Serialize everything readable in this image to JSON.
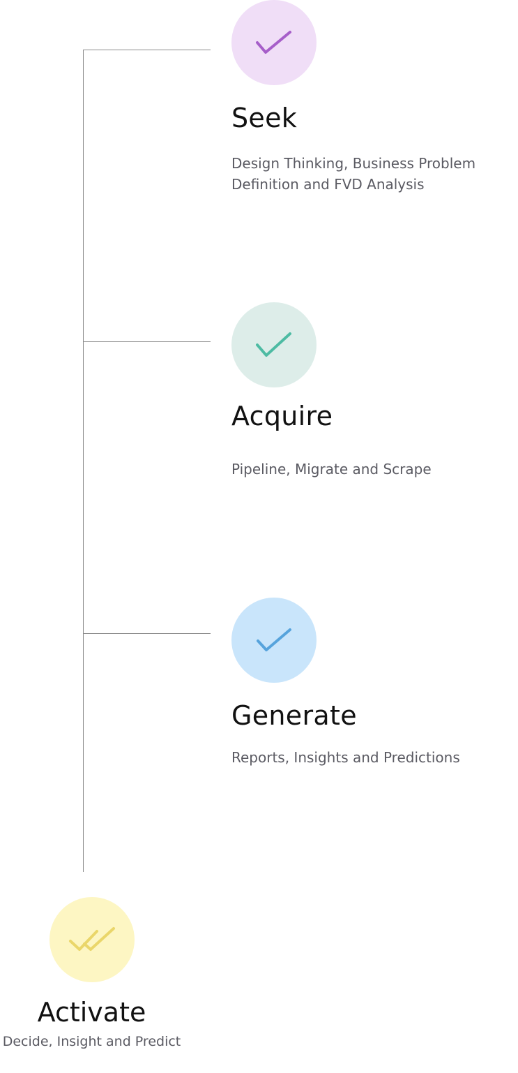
{
  "steps": [
    {
      "title": "Seek",
      "description": "Design Thinking, Business Problem Definition and FVD Analysis",
      "icon": "check-icon",
      "circle_color": "#f0def7",
      "check_color": "#a65ec9"
    },
    {
      "title": "Acquire",
      "description": "Pipeline, Migrate and Scrape",
      "icon": "check-icon",
      "circle_color": "#ddede9",
      "check_color": "#4dbba3"
    },
    {
      "title": "Generate",
      "description": "Reports, Insights and Predictions",
      "icon": "check-icon",
      "circle_color": "#c9e5fb",
      "check_color": "#56a3dc"
    }
  ],
  "final": {
    "title": "Activate",
    "description": "Decide, Insight and Predict",
    "icon": "double-check-icon",
    "circle_color": "#fdf6c3",
    "check_color": "#ead66a"
  },
  "line_color": "#8a8a8a"
}
